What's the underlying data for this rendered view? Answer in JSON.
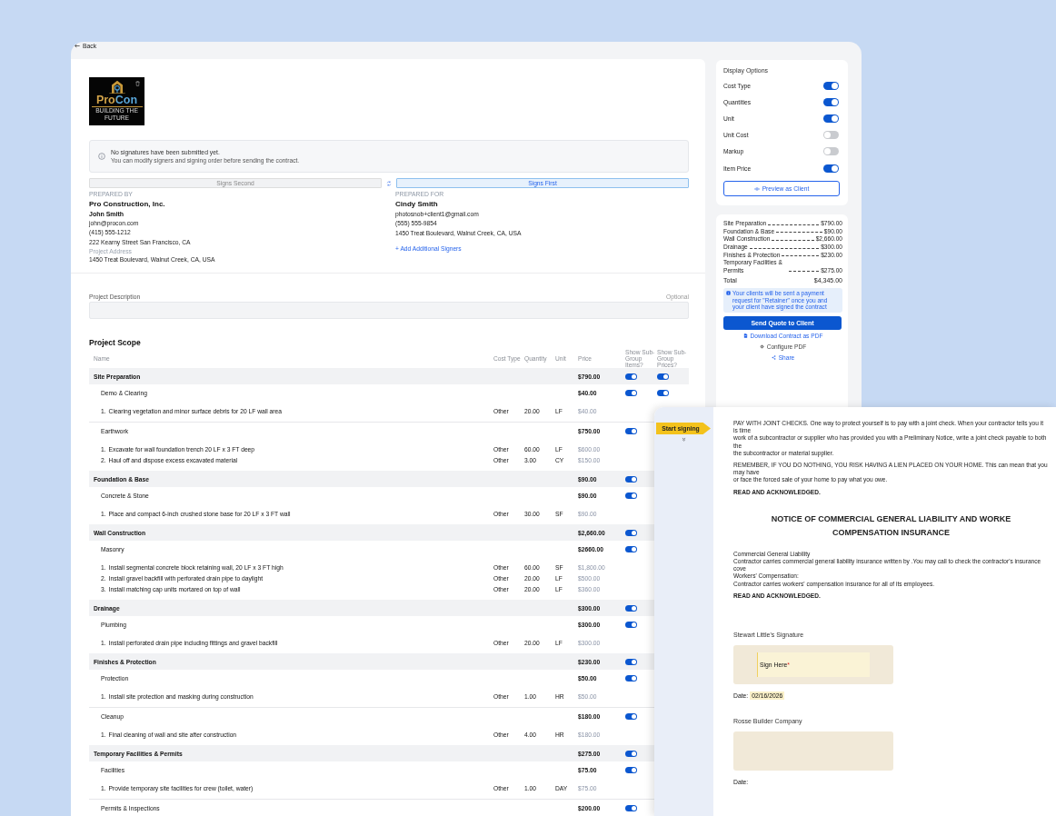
{
  "back": "Back",
  "logo": {
    "name": "ProCon",
    "tagline": "BUILDING THE FUTURE"
  },
  "notice": {
    "title": "No signatures have been submitted yet.",
    "text": "You can modify signers and signing order before sending the contract."
  },
  "signing_order": [
    {
      "label": "Signs Second",
      "selected": false
    },
    {
      "label": "Signs First",
      "selected": true
    }
  ],
  "prepared_by": {
    "heading": "PREPARED BY",
    "company": "Pro Construction, Inc.",
    "name": "John Smith",
    "email": "john@procon.com",
    "phone": "(415) 555-1212",
    "address": "222 Kearny Street San Francisco, CA",
    "address_label": "Project Address",
    "project_address": "1450 Treat Boulevard, Walnut Creek, CA, USA"
  },
  "prepared_for": {
    "heading": "PREPARED FOR",
    "name": "Cindy Smith",
    "email": "photosnob+client1@gmail.com",
    "phone": "(555) 555-9854",
    "address": "1450 Treat Boulevard, Walnut Creek, CA, USA",
    "add_link": "+ Add Additional Signers"
  },
  "project_description": {
    "label": "Project Description",
    "hint": "Optional"
  },
  "scope": {
    "title": "Project Scope",
    "columns": [
      "Name",
      "Cost Type",
      "Quantity",
      "Unit",
      "Price",
      "Show Sub-Group Items?",
      "Show Sub-Group Prices?"
    ],
    "groups": [
      {
        "name": "Site Preparation",
        "price": "$790.00",
        "show_items": true,
        "show_prices": true,
        "subgroups": [
          {
            "name": "Demo & Clearing",
            "price": "$40.00",
            "show_items": true,
            "show_prices": true,
            "items": [
              {
                "no": "1.",
                "text": "Clearing vegetation and minor surface debris for 20 LF wall area",
                "cost_type": "Other",
                "quantity": "20.00",
                "unit": "LF",
                "price": "$40.00"
              }
            ]
          },
          {
            "name": "Earthwork",
            "price": "$750.00",
            "show_items": true,
            "items": [
              {
                "no": "1.",
                "text": "Excavate for wall foundation trench 20 LF x 3 FT deep",
                "cost_type": "Other",
                "quantity": "60.00",
                "unit": "LF",
                "price": "$600.00"
              },
              {
                "no": "2.",
                "text": "Haul off and dispose excess excavated material",
                "cost_type": "Other",
                "quantity": "3.00",
                "unit": "CY",
                "price": "$150.00"
              }
            ]
          }
        ]
      },
      {
        "name": "Foundation & Base",
        "price": "$90.00",
        "show_items": true,
        "subgroups": [
          {
            "name": "Concrete & Stone",
            "price": "$90.00",
            "show_items": true,
            "items": [
              {
                "no": "1.",
                "text": "Place and compact 6-inch crushed stone base for 20 LF x 3 FT wall",
                "cost_type": "Other",
                "quantity": "30.00",
                "unit": "SF",
                "price": "$90.00"
              }
            ]
          }
        ]
      },
      {
        "name": "Wall Construction",
        "price": "$2,660.00",
        "show_items": true,
        "subgroups": [
          {
            "name": "Masonry",
            "price": "$2660.00",
            "show_items": true,
            "items": [
              {
                "no": "1.",
                "text": "Install segmental concrete block retaining wall, 20 LF x 3 FT high",
                "cost_type": "Other",
                "quantity": "60.00",
                "unit": "SF",
                "price": "$1,800.00"
              },
              {
                "no": "2.",
                "text": "Install gravel backfill with perforated drain pipe to daylight",
                "cost_type": "Other",
                "quantity": "20.00",
                "unit": "LF",
                "price": "$500.00"
              },
              {
                "no": "3.",
                "text": "Install matching cap units mortared on top of wall",
                "cost_type": "Other",
                "quantity": "20.00",
                "unit": "LF",
                "price": "$360.00"
              }
            ]
          }
        ]
      },
      {
        "name": "Drainage",
        "price": "$300.00",
        "show_items": true,
        "subgroups": [
          {
            "name": "Plumbing",
            "price": "$300.00",
            "show_items": true,
            "items": [
              {
                "no": "1.",
                "text": "Install perforated drain pipe including fittings and gravel backfill",
                "cost_type": "Other",
                "quantity": "20.00",
                "unit": "LF",
                "price": "$300.00"
              }
            ]
          }
        ]
      },
      {
        "name": "Finishes & Protection",
        "price": "$230.00",
        "show_items": true,
        "subgroups": [
          {
            "name": "Protection",
            "price": "$50.00",
            "show_items": true,
            "items": [
              {
                "no": "1.",
                "text": "Install site protection and masking during construction",
                "cost_type": "Other",
                "quantity": "1.00",
                "unit": "HR",
                "price": "$50.00"
              }
            ]
          },
          {
            "name": "Cleanup",
            "price": "$180.00",
            "show_items": true,
            "items": [
              {
                "no": "1.",
                "text": "Final cleaning of wall and site after construction",
                "cost_type": "Other",
                "quantity": "4.00",
                "unit": "HR",
                "price": "$180.00"
              }
            ]
          }
        ]
      },
      {
        "name": "Temporary Facilities & Permits",
        "price": "$275.00",
        "show_items": true,
        "subgroups": [
          {
            "name": "Facilities",
            "price": "$75.00",
            "show_items": true,
            "items": [
              {
                "no": "1.",
                "text": "Provide temporary site facilities for crew (toilet, water)",
                "cost_type": "Other",
                "quantity": "1.00",
                "unit": "DAY",
                "price": "$75.00"
              }
            ]
          },
          {
            "name": "Permits & Inspections",
            "price": "$200.00",
            "show_items": true
          }
        ]
      }
    ]
  },
  "display_options": {
    "title": "Display Options",
    "options": [
      {
        "label": "Cost Type",
        "on": true
      },
      {
        "label": "Quantities",
        "on": true
      },
      {
        "label": "Unit",
        "on": true
      },
      {
        "label": "Unit Cost",
        "on": false
      },
      {
        "label": "Markup",
        "on": false
      },
      {
        "label": "Item Price",
        "on": true
      }
    ],
    "preview_button": "Preview as Client"
  },
  "summary": {
    "lines": [
      {
        "label": "Site Preparation",
        "amount": "$790.00"
      },
      {
        "label": "Foundation & Base",
        "amount": "$90.00"
      },
      {
        "label": "Wall Construction",
        "amount": "$2,660.00"
      },
      {
        "label": "Drainage",
        "amount": "$300.00"
      },
      {
        "label": "Finishes & Protection",
        "amount": "$230.00"
      },
      {
        "label": "Temporary Facilities & Permits",
        "amount": "$275.00"
      }
    ],
    "total_label": "Total",
    "total": "$4,345.00",
    "info": "Your clients will be sent a payment request for \"Retainer\" once you and your client have signed the contract",
    "send_button": "Send Quote to Client",
    "links": [
      {
        "kind": "pdf",
        "label": "Download Contract as PDF"
      },
      {
        "kind": "gear",
        "label": "Configure PDF"
      },
      {
        "kind": "share",
        "label": "Share"
      }
    ]
  },
  "signing": {
    "start_button": "Start signing",
    "blocks": [
      {
        "kind": "text",
        "lines": [
          "PAY WITH JOINT CHECKS. One way to protect yourself is to pay with a joint check. When your contractor tells you it is time",
          "work of a subcontractor or supplier who has provided you with a Preliminary Notice, write a joint check payable to both the",
          "the subcontractor or material supplier."
        ]
      },
      {
        "kind": "text",
        "lines": [
          "REMEMBER, IF YOU DO NOTHING, YOU RISK HAVING A LIEN PLACED ON YOUR HOME. This can mean that you may have",
          "or face the forced sale of your home to pay what you owe."
        ]
      },
      {
        "kind": "ack",
        "lines": [
          "READ AND ACKNOWLEDGED."
        ]
      },
      {
        "kind": "title",
        "lines": [
          "NOTICE OF COMMERCIAL GENERAL LIABILITY AND WORKE",
          "COMPENSATION INSURANCE"
        ]
      },
      {
        "kind": "text",
        "lines": [
          "Commercial General Liability",
          "Contractor carries commercial general liability insurance written by   .You may call    to check the contractor's insurance cove",
          "Workers' Compensation:",
          "Contractor carries workers' compensation insurance for all of its employees."
        ]
      },
      {
        "kind": "ack",
        "lines": [
          "READ AND ACKNOWLEDGED."
        ]
      },
      {
        "kind": "signature",
        "label": "Stewart Little's Signature",
        "field": "Sign Here",
        "required_mark": "*",
        "date_label": "Date:",
        "date": "02/16/2026"
      },
      {
        "kind": "signature",
        "label": "Rosse Builder Company",
        "date_label": "Date:"
      }
    ]
  }
}
